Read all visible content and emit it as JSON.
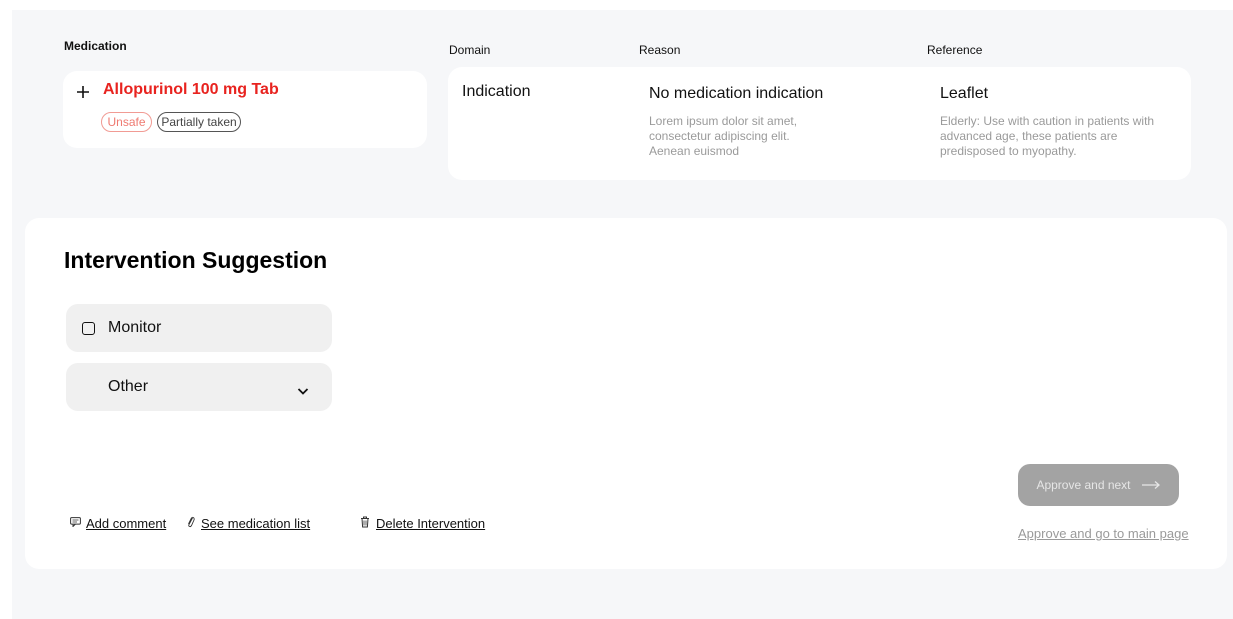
{
  "headers": {
    "medication": "Medication",
    "domain": "Domain",
    "reason": "Reason",
    "reference": "Reference"
  },
  "medication": {
    "name": "Allopurinol 100 mg Tab",
    "add_icon": "plus-icon",
    "tags": [
      "Unsafe",
      "Partially taken"
    ]
  },
  "detail": {
    "domain": "Indication",
    "reason_title": "No medication indication",
    "reason_lines": [
      "Lorem ipsum dolor sit amet,",
      "consectetur adipiscing elit.",
      "Aenean euismod"
    ],
    "reference_title": "Leaflet",
    "reference_lines": [
      "Elderly: Use with caution in patients with",
      "advanced age, these patients are",
      "predisposed to myopathy."
    ]
  },
  "intervention": {
    "title": "Intervention Suggestion",
    "options": {
      "monitor": "Monitor",
      "other": "Other"
    }
  },
  "footer": {
    "add_comment": "Add comment",
    "see_medication_list": "See medication list",
    "delete_intervention": "Delete Intervention",
    "approve_next": "Approve and next",
    "approve_main": "Approve and go to main page"
  },
  "colors": {
    "danger": "#e8231f",
    "unsafe_pill": "#ef7a71",
    "disabled_button": "#a3a3a3",
    "background": "#f6f7f9"
  }
}
